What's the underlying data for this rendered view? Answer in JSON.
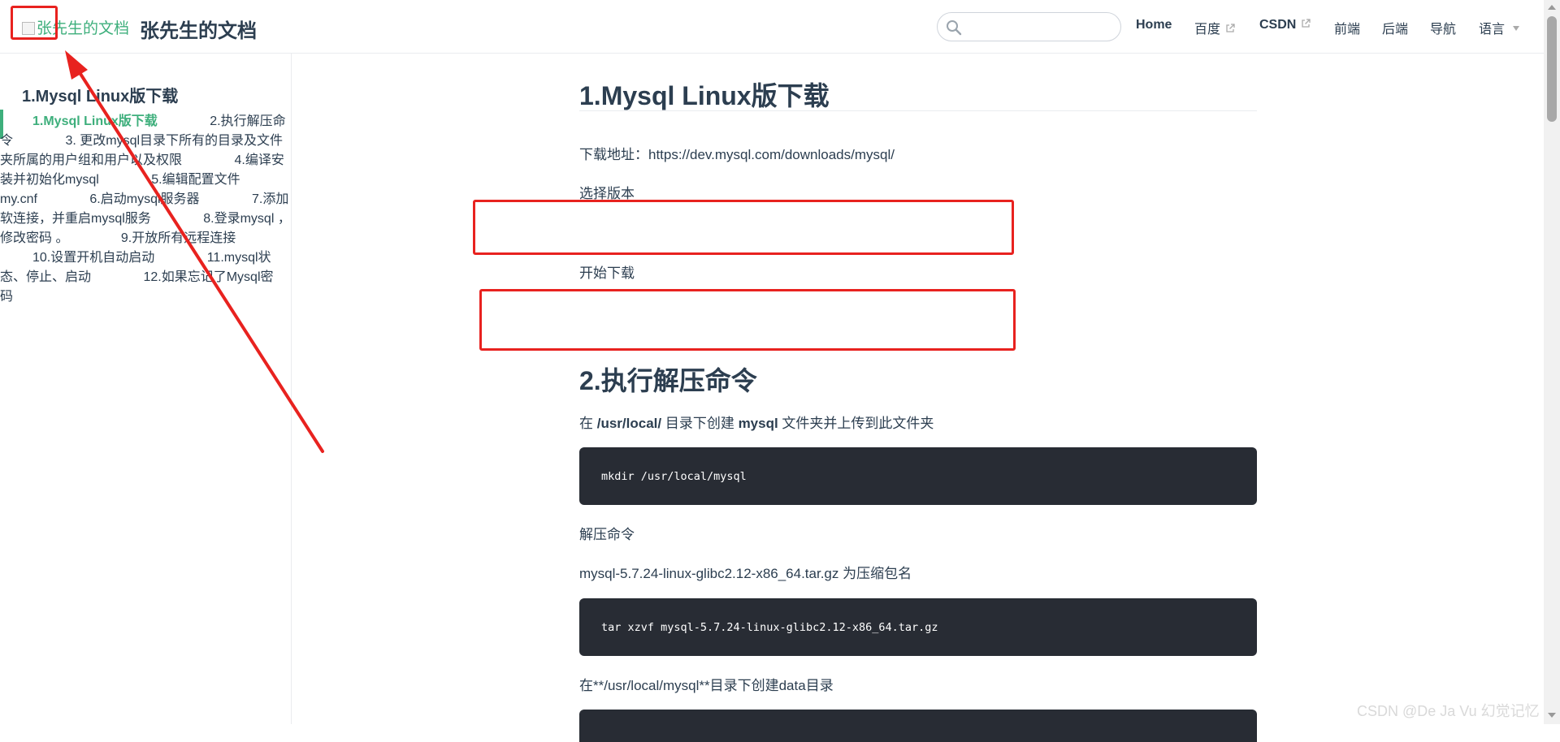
{
  "navbar": {
    "logo_alt": "张先生的文档",
    "site_title": "张先生的文档",
    "search": {
      "placeholder": "",
      "value": ""
    },
    "links": [
      {
        "label": "Home"
      },
      {
        "label": "百度"
      },
      {
        "label": "CSDN"
      },
      {
        "label": "前端"
      },
      {
        "label": "后端"
      },
      {
        "label": "导航"
      },
      {
        "label": "语言"
      }
    ]
  },
  "sidebar": {
    "heading": "1.Mysql Linux版下载",
    "items": [
      {
        "label": "1.Mysql Linux版下载",
        "active": true
      },
      {
        "label": "2.执行解压命令"
      },
      {
        "label": "3. 更改mysql目录下所有的目录及文件夹所属的用户组和用户以及权限"
      },
      {
        "label": "4.编译安装并初始化mysql"
      },
      {
        "label": "5.编辑配置文件my.cnf"
      },
      {
        "label": "6.启动mysql服务器"
      },
      {
        "label": "7.添加软连接，并重启mysql服务"
      },
      {
        "label": "8.登录mysql ， 修改密码 。"
      },
      {
        "label": "9.开放所有远程连接"
      },
      {
        "label": "10.设置开机自动启动"
      },
      {
        "label": "11.mysql状态、停止、启动"
      },
      {
        "label": "12.如果忘记了Mysql密码"
      }
    ]
  },
  "content": {
    "section1": {
      "title": "1.Mysql Linux版下载",
      "download_line": "下载地址：https://dev.mysql.com/downloads/mysql/",
      "choose_version": "选择版本",
      "start_download": "开始下载"
    },
    "section2": {
      "title": "2.执行解压命令",
      "intro_prefix": "在 ",
      "intro_path": "/usr/local/",
      "intro_mid": " 目录下创建 ",
      "intro_dir": "mysql",
      "intro_suffix": " 文件夹并上传到此文件夹",
      "code1": "mkdir /usr/local/mysql",
      "unzip_label": "解压命令",
      "package_note": "mysql-5.7.24-linux-glibc2.12-x86_64.tar.gz 为压缩包名",
      "code2": "tar xzvf mysql-5.7.24-linux-glibc2.12-x86_64.tar.gz",
      "data_dir_note": "在**/usr/local/mysql**目录下创建data目录"
    }
  },
  "watermark": "CSDN @De Ja Vu 幻觉记忆",
  "colors": {
    "accent": "#3eaf7c",
    "text": "#2c3e50",
    "code_bg": "#282c34",
    "annotation": "#e8221f"
  }
}
